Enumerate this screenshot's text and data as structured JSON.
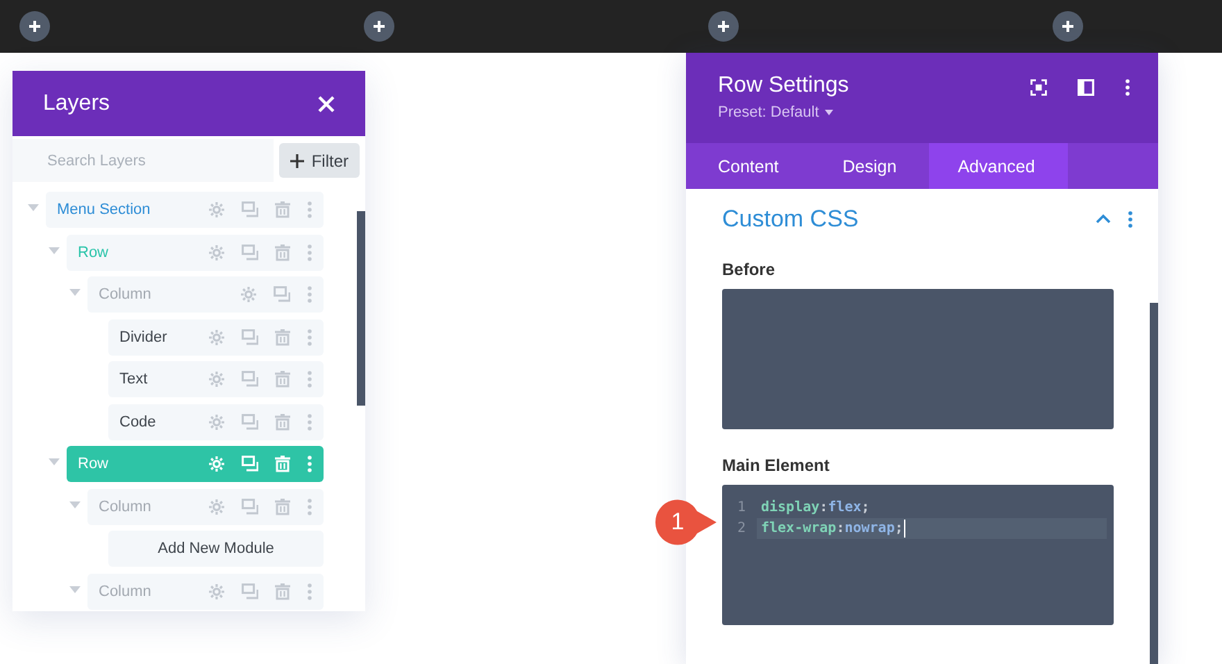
{
  "top_bar": {
    "add_buttons": [
      {
        "kind": "add"
      },
      {
        "kind": "add"
      },
      {
        "kind": "add"
      },
      {
        "kind": "add"
      }
    ]
  },
  "layers_panel": {
    "title": "Layers",
    "search": {
      "placeholder": "Search Layers"
    },
    "filter_button": "Filter",
    "tree": [
      {
        "label": "Menu Section",
        "kind": "section",
        "selected": false,
        "expanded": true,
        "deletable": true,
        "children": [
          {
            "label": "Row",
            "kind": "row",
            "selected": false,
            "expanded": true,
            "deletable": true,
            "children": [
              {
                "label": "Column",
                "kind": "column",
                "selected": false,
                "expanded": true,
                "deletable": false,
                "children": [
                  {
                    "label": "Divider",
                    "kind": "module",
                    "selected": false,
                    "deletable": true
                  },
                  {
                    "label": "Text",
                    "kind": "module",
                    "selected": false,
                    "deletable": true
                  },
                  {
                    "label": "Code",
                    "kind": "module",
                    "selected": false,
                    "deletable": true
                  }
                ]
              }
            ]
          },
          {
            "label": "Row",
            "kind": "row",
            "selected": true,
            "expanded": true,
            "deletable": true,
            "children": [
              {
                "label": "Column",
                "kind": "column",
                "selected": false,
                "expanded": true,
                "deletable": true,
                "children": [
                  {
                    "label": "Add New Module",
                    "kind": "add"
                  }
                ]
              },
              {
                "label": "Column",
                "kind": "column",
                "selected": false,
                "expanded": true,
                "deletable": true
              }
            ]
          }
        ]
      }
    ]
  },
  "settings_panel": {
    "title": "Row Settings",
    "preset": "Preset: Default",
    "tabs": [
      {
        "label": "Content",
        "selected": false
      },
      {
        "label": "Design",
        "selected": false
      },
      {
        "label": "Advanced",
        "selected": true
      }
    ],
    "section": {
      "title": "Custom CSS",
      "expanded": true,
      "fields": [
        {
          "label": "Before"
        },
        {
          "label": "Main Element",
          "lines": [
            {
              "number": "1",
              "active": false,
              "tokens": [
                {
                  "kind": "property",
                  "text": "display"
                },
                {
                  "kind": "punct",
                  "text": ":"
                },
                {
                  "kind": "value",
                  "text": "flex"
                },
                {
                  "kind": "punct",
                  "text": ";"
                }
              ]
            },
            {
              "number": "2",
              "active": true,
              "tokens": [
                {
                  "kind": "property",
                  "text": "flex-wrap"
                },
                {
                  "kind": "punct",
                  "text": ":"
                },
                {
                  "kind": "value",
                  "text": "nowrap"
                },
                {
                  "kind": "punct",
                  "text": ";"
                }
              ]
            }
          ]
        }
      ]
    }
  },
  "callout": {
    "text": "1"
  }
}
